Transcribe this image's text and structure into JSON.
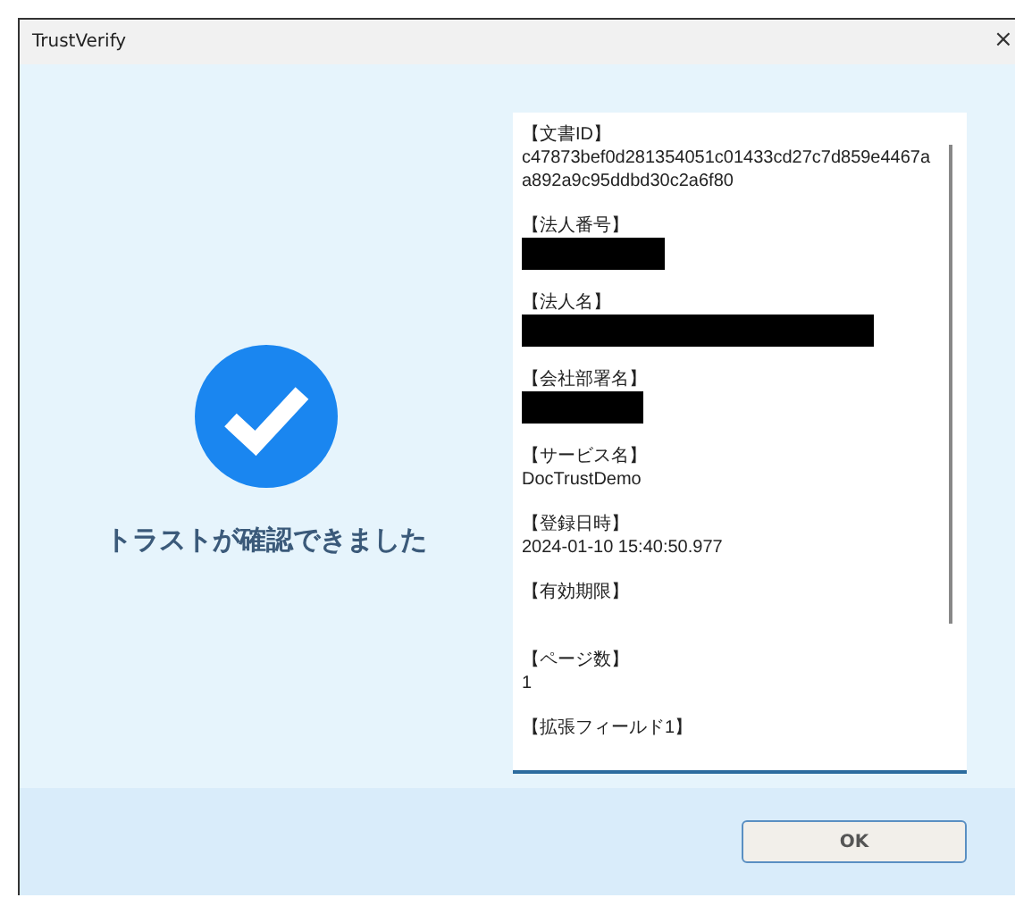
{
  "window": {
    "title": "TrustVerify",
    "close": "×"
  },
  "status": {
    "verified": true,
    "message": "トラストが確認できました"
  },
  "fields": [
    {
      "kind": "text",
      "label": "【文書ID】",
      "value": "c47873bef0d281354051c01433cd27c7d859e4467aa892a9c95ddbd30c2a6f80"
    },
    {
      "kind": "redacted",
      "label": "【法人番号】"
    },
    {
      "kind": "redacted",
      "label": "【法人名】"
    },
    {
      "kind": "redacted",
      "label": "【会社部署名】"
    },
    {
      "kind": "text",
      "label": "【サービス名】",
      "value": "DocTrustDemo"
    },
    {
      "kind": "text",
      "label": "【登録日時】",
      "value": "2024-01-10 15:40:50.977"
    },
    {
      "kind": "empty",
      "label": "【有効期限】"
    },
    {
      "kind": "text",
      "label": "【ページ数】",
      "value": "1"
    },
    {
      "kind": "empty",
      "label": "【拡張フィールド1】"
    }
  ],
  "buttons": [
    {
      "label": "OK"
    }
  ]
}
